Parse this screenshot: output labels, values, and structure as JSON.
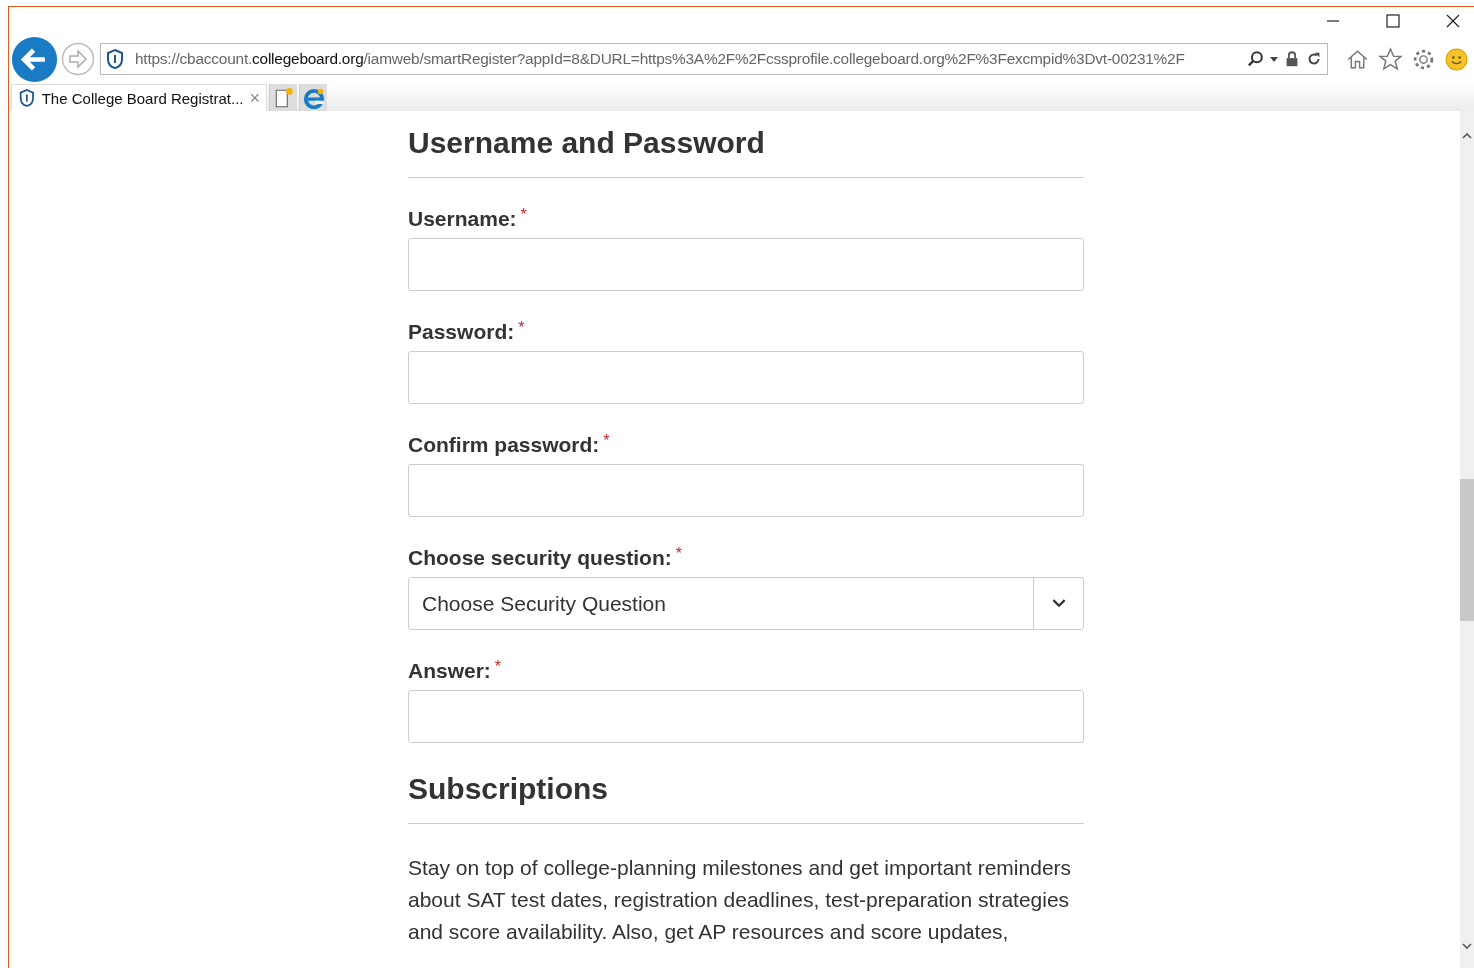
{
  "address_bar": {
    "url": "https://cbaccount.**collegeboard.org**/iamweb/smartRegister?appId=8&DURL=https%3A%2F%2Fcssprofile.collegeboard.org%2F%3Fexcmpid%3Dvt-00231%2F"
  },
  "tabs": [
    {
      "title": "The College Board Registrat...",
      "close": "×",
      "selected": true
    }
  ],
  "sections": [
    {
      "heading": "Username and Password",
      "fields": [
        {
          "kind": "text",
          "label": "Username:",
          "required_mark": "*"
        },
        {
          "kind": "password",
          "label": "Password:",
          "required_mark": "*"
        },
        {
          "kind": "password",
          "label": "Confirm password:",
          "required_mark": "*"
        },
        {
          "kind": "select",
          "label": "Choose security question:",
          "required_mark": "*",
          "value": "Choose Security Question"
        },
        {
          "kind": "text",
          "label": "Answer:",
          "required_mark": "*"
        }
      ]
    },
    {
      "heading": "Subscriptions",
      "paragraph": "Stay on top of college-planning milestones and get important reminders about SAT test dates, registration deadlines, test-preparation strategies and score availability. Also, get AP resources and score updates,"
    }
  ]
}
